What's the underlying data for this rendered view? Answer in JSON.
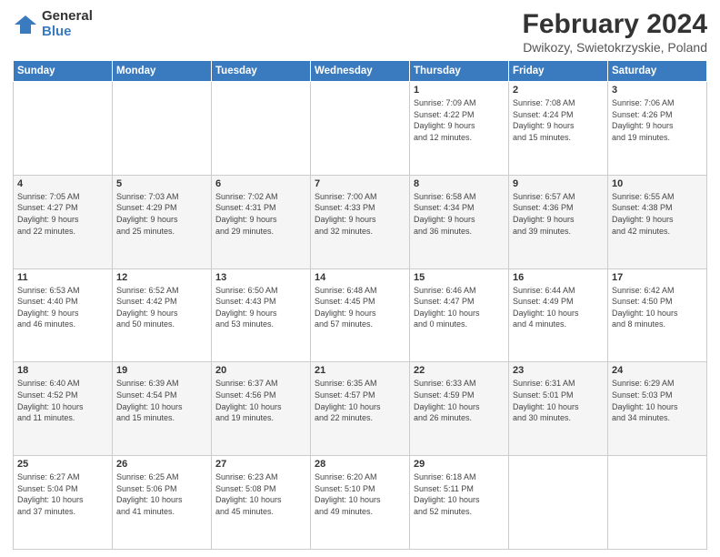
{
  "header": {
    "logo_general": "General",
    "logo_blue": "Blue",
    "title": "February 2024",
    "location": "Dwikozy, Swietokrzyskie, Poland"
  },
  "days_of_week": [
    "Sunday",
    "Monday",
    "Tuesday",
    "Wednesday",
    "Thursday",
    "Friday",
    "Saturday"
  ],
  "weeks": [
    [
      {
        "day": "",
        "info": ""
      },
      {
        "day": "",
        "info": ""
      },
      {
        "day": "",
        "info": ""
      },
      {
        "day": "",
        "info": ""
      },
      {
        "day": "1",
        "info": "Sunrise: 7:09 AM\nSunset: 4:22 PM\nDaylight: 9 hours\nand 12 minutes."
      },
      {
        "day": "2",
        "info": "Sunrise: 7:08 AM\nSunset: 4:24 PM\nDaylight: 9 hours\nand 15 minutes."
      },
      {
        "day": "3",
        "info": "Sunrise: 7:06 AM\nSunset: 4:26 PM\nDaylight: 9 hours\nand 19 minutes."
      }
    ],
    [
      {
        "day": "4",
        "info": "Sunrise: 7:05 AM\nSunset: 4:27 PM\nDaylight: 9 hours\nand 22 minutes."
      },
      {
        "day": "5",
        "info": "Sunrise: 7:03 AM\nSunset: 4:29 PM\nDaylight: 9 hours\nand 25 minutes."
      },
      {
        "day": "6",
        "info": "Sunrise: 7:02 AM\nSunset: 4:31 PM\nDaylight: 9 hours\nand 29 minutes."
      },
      {
        "day": "7",
        "info": "Sunrise: 7:00 AM\nSunset: 4:33 PM\nDaylight: 9 hours\nand 32 minutes."
      },
      {
        "day": "8",
        "info": "Sunrise: 6:58 AM\nSunset: 4:34 PM\nDaylight: 9 hours\nand 36 minutes."
      },
      {
        "day": "9",
        "info": "Sunrise: 6:57 AM\nSunset: 4:36 PM\nDaylight: 9 hours\nand 39 minutes."
      },
      {
        "day": "10",
        "info": "Sunrise: 6:55 AM\nSunset: 4:38 PM\nDaylight: 9 hours\nand 42 minutes."
      }
    ],
    [
      {
        "day": "11",
        "info": "Sunrise: 6:53 AM\nSunset: 4:40 PM\nDaylight: 9 hours\nand 46 minutes."
      },
      {
        "day": "12",
        "info": "Sunrise: 6:52 AM\nSunset: 4:42 PM\nDaylight: 9 hours\nand 50 minutes."
      },
      {
        "day": "13",
        "info": "Sunrise: 6:50 AM\nSunset: 4:43 PM\nDaylight: 9 hours\nand 53 minutes."
      },
      {
        "day": "14",
        "info": "Sunrise: 6:48 AM\nSunset: 4:45 PM\nDaylight: 9 hours\nand 57 minutes."
      },
      {
        "day": "15",
        "info": "Sunrise: 6:46 AM\nSunset: 4:47 PM\nDaylight: 10 hours\nand 0 minutes."
      },
      {
        "day": "16",
        "info": "Sunrise: 6:44 AM\nSunset: 4:49 PM\nDaylight: 10 hours\nand 4 minutes."
      },
      {
        "day": "17",
        "info": "Sunrise: 6:42 AM\nSunset: 4:50 PM\nDaylight: 10 hours\nand 8 minutes."
      }
    ],
    [
      {
        "day": "18",
        "info": "Sunrise: 6:40 AM\nSunset: 4:52 PM\nDaylight: 10 hours\nand 11 minutes."
      },
      {
        "day": "19",
        "info": "Sunrise: 6:39 AM\nSunset: 4:54 PM\nDaylight: 10 hours\nand 15 minutes."
      },
      {
        "day": "20",
        "info": "Sunrise: 6:37 AM\nSunset: 4:56 PM\nDaylight: 10 hours\nand 19 minutes."
      },
      {
        "day": "21",
        "info": "Sunrise: 6:35 AM\nSunset: 4:57 PM\nDaylight: 10 hours\nand 22 minutes."
      },
      {
        "day": "22",
        "info": "Sunrise: 6:33 AM\nSunset: 4:59 PM\nDaylight: 10 hours\nand 26 minutes."
      },
      {
        "day": "23",
        "info": "Sunrise: 6:31 AM\nSunset: 5:01 PM\nDaylight: 10 hours\nand 30 minutes."
      },
      {
        "day": "24",
        "info": "Sunrise: 6:29 AM\nSunset: 5:03 PM\nDaylight: 10 hours\nand 34 minutes."
      }
    ],
    [
      {
        "day": "25",
        "info": "Sunrise: 6:27 AM\nSunset: 5:04 PM\nDaylight: 10 hours\nand 37 minutes."
      },
      {
        "day": "26",
        "info": "Sunrise: 6:25 AM\nSunset: 5:06 PM\nDaylight: 10 hours\nand 41 minutes."
      },
      {
        "day": "27",
        "info": "Sunrise: 6:23 AM\nSunset: 5:08 PM\nDaylight: 10 hours\nand 45 minutes."
      },
      {
        "day": "28",
        "info": "Sunrise: 6:20 AM\nSunset: 5:10 PM\nDaylight: 10 hours\nand 49 minutes."
      },
      {
        "day": "29",
        "info": "Sunrise: 6:18 AM\nSunset: 5:11 PM\nDaylight: 10 hours\nand 52 minutes."
      },
      {
        "day": "",
        "info": ""
      },
      {
        "day": "",
        "info": ""
      }
    ]
  ]
}
